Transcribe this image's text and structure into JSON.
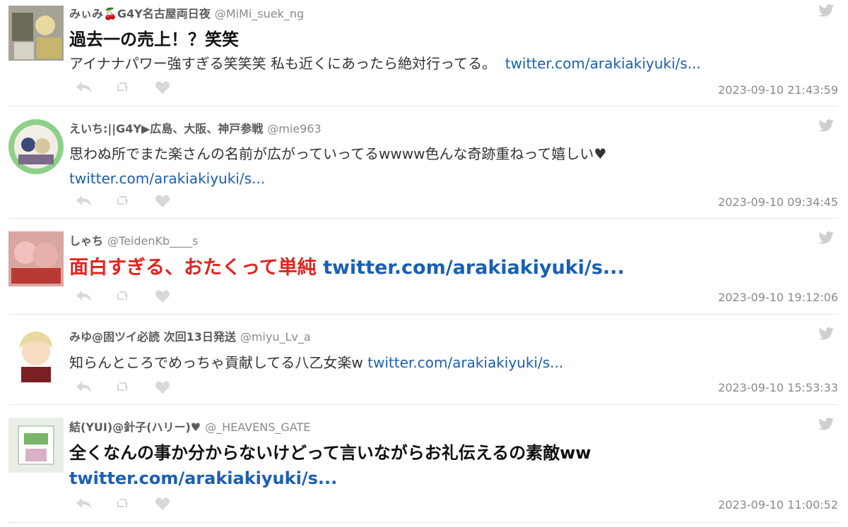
{
  "tweets": [
    {
      "name": "みぃみ🍒G4Y名古屋両日夜",
      "handle": "@MiMi_suek_ng",
      "text_lines": [
        "過去一の売上！？笑笑"
      ],
      "text2": "アイナナパワー強すぎる笑笑笑 私も近くにあったら絶対行ってる。",
      "link": "twitter.com/arakiakiyuki/s...",
      "time": "2023-09-10 21:43:59",
      "icons": {
        "reply": "reply-icon",
        "retweet": "retweet-icon",
        "like": "heart-icon",
        "source": "twitter-bird-icon"
      }
    },
    {
      "name": "えいち:||G4Y▶広島、大阪、神戸参戦",
      "handle": "@mie963",
      "text": "思わぬ所でまた楽さんの名前が広がっていってるwwww色んな奇跡重ねって嬉しい♥",
      "link": "twitter.com/arakiakiyuki/s...",
      "time": "2023-09-10 09:34:45"
    },
    {
      "name": "しゃち",
      "handle": "@TeidenKb____s",
      "text": "面白すぎる、おたくって単純",
      "link": "twitter.com/arakiakiyuki/s...",
      "time": "2023-09-10 19:12:06"
    },
    {
      "name": "みゆ@固ツイ必読 次回13日発送",
      "handle": "@miyu_Lv_a",
      "text": "知らんところでめっちゃ貢献してる八乙女楽w",
      "link": "twitter.com/arakiakiyuki/s...",
      "time": "2023-09-10 15:53:33"
    },
    {
      "name": "結(YUI)@針子(ハリー)♥",
      "handle": "@_HEAVENS_GATE",
      "text": "全くなんの事か分からないけどって言いながらお礼伝えるの素敵ww",
      "link": "twitter.com/arakiakiyuki/s...",
      "time": "2023-09-10 11:00:52"
    }
  ],
  "colors": {
    "link": "#1a5fb4",
    "red_text": "#e0241f",
    "muted": "#8a8a8a"
  }
}
